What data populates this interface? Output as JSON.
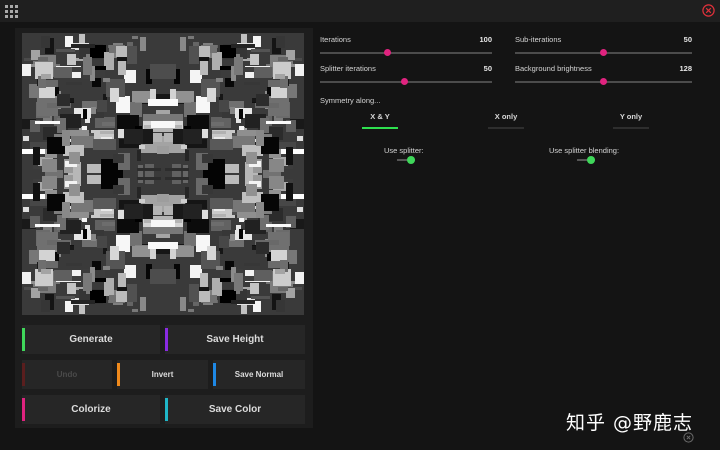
{
  "window": {
    "menu_icon": "grid-dots-icon",
    "close_icon": "close-circle-icon",
    "close_color": "#e0313b"
  },
  "buttons": {
    "generate": "Generate",
    "save_height": "Save Height",
    "undo": "Undo",
    "invert": "Invert",
    "save_normal": "Save Normal",
    "colorize": "Colorize",
    "save_color": "Save Color"
  },
  "button_accents": {
    "generate": "#3fd75a",
    "save_height": "#8a2be2",
    "undo": "#5a1e1e",
    "invert": "#f08a1c",
    "save_normal": "#1e88e5",
    "colorize": "#e0237f",
    "save_color": "#1fb6c7"
  },
  "sliders": [
    {
      "label": "Iterations",
      "value": "100",
      "fraction": 0.39
    },
    {
      "label": "Sub-iterations",
      "value": "50",
      "fraction": 0.5
    },
    {
      "label": "Splitter iterations",
      "value": "50",
      "fraction": 0.49
    },
    {
      "label": "Background brightness",
      "value": "128",
      "fraction": 0.5
    }
  ],
  "symmetry": {
    "label": "Symmetry along...",
    "options": [
      "X & Y",
      "X only",
      "Y only"
    ],
    "selected": "X & Y"
  },
  "toggles": {
    "use_splitter": {
      "label": "Use splitter:",
      "on": true
    },
    "use_splitter_blending": {
      "label": "Use splitter blending:",
      "on": true
    }
  },
  "accent_slider": "#e0237f",
  "accent_selected": "#2ee04f",
  "watermark": "知乎 @野鹿志",
  "footer_icon": "circle-x-icon"
}
